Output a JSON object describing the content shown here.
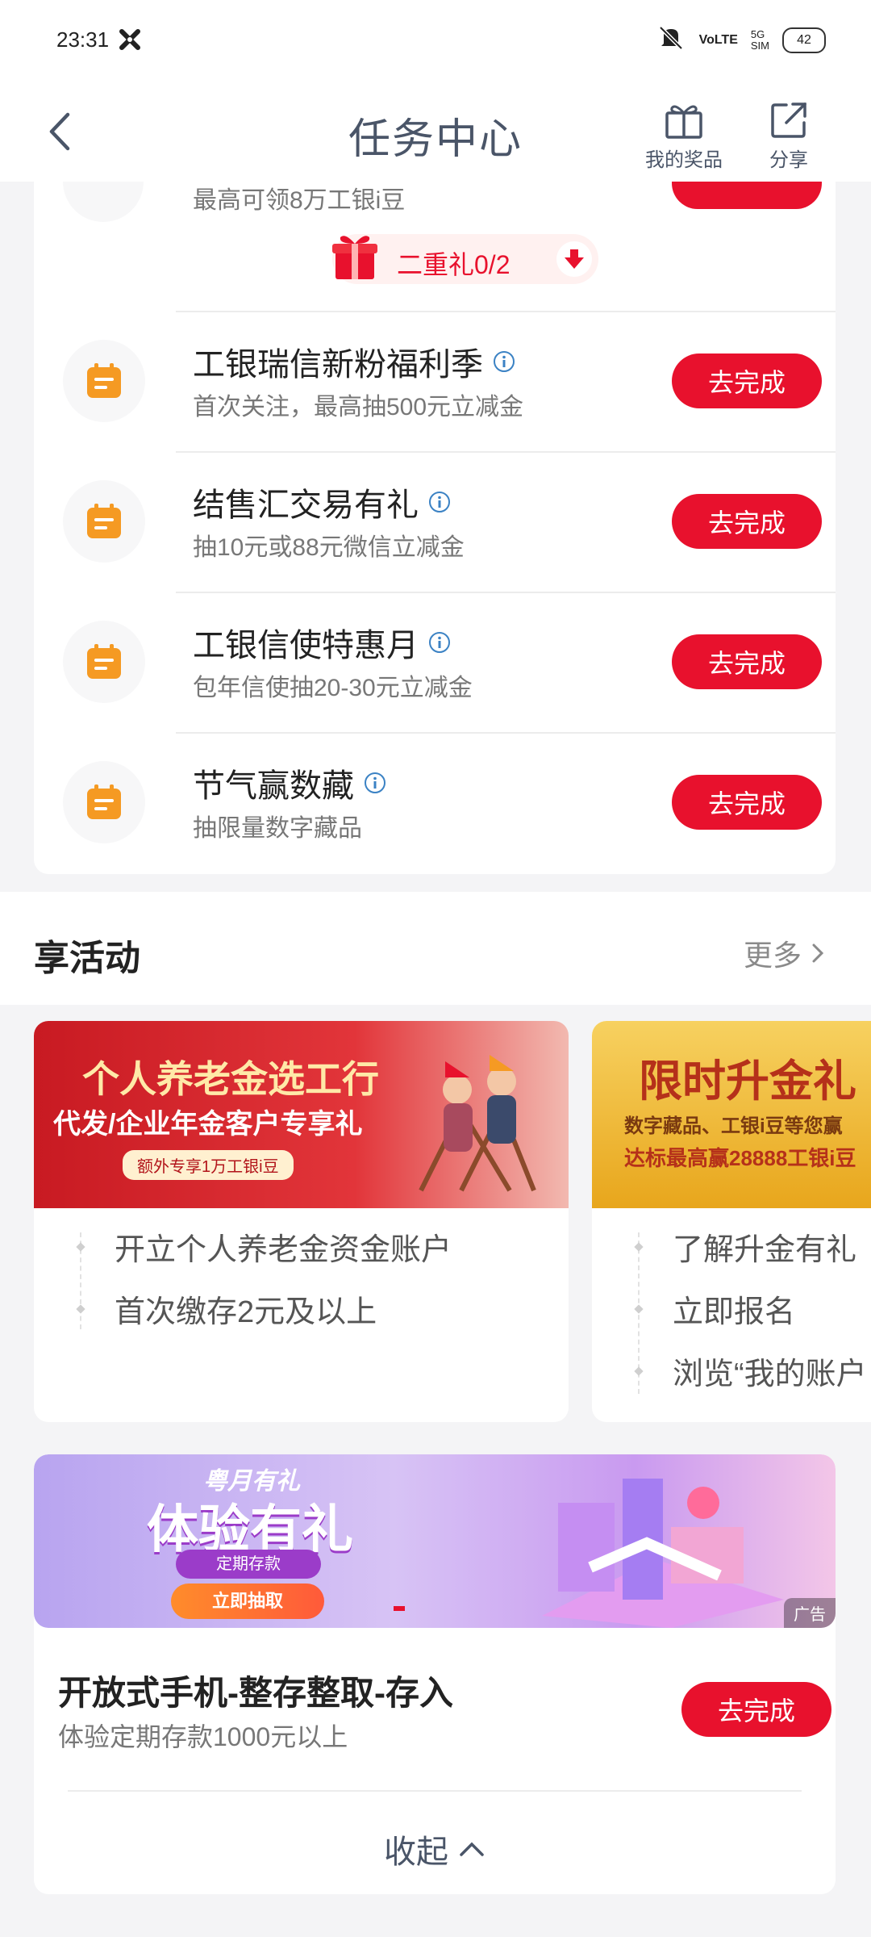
{
  "status_bar": {
    "time": "23:31",
    "signal_5g": "5G",
    "signal_sim": "SIM",
    "volte": "VoLTE",
    "battery": "42"
  },
  "header": {
    "title": "任务中心",
    "back_icon": "chevron-left-icon",
    "my_prizes": "我的奖品",
    "share": "分享"
  },
  "tasks": {
    "partial_subtitle": "最高可领8万工银i豆",
    "gift_label": "二重礼0/2",
    "items": [
      {
        "title": "工银瑞信新粉福利季",
        "subtitle": "首次关注，最高抽500元立减金",
        "button": "去完成"
      },
      {
        "title": "结售汇交易有礼",
        "subtitle": "抽10元或88元微信立减金",
        "button": "去完成"
      },
      {
        "title": "工银信使特惠月",
        "subtitle": "包年信使抽20-30元立减金",
        "button": "去完成"
      },
      {
        "title": "节气赢数藏",
        "subtitle": "抽限量数字藏品",
        "button": "去完成"
      }
    ]
  },
  "activities": {
    "section_title": "享活动",
    "more": "更多",
    "cards": [
      {
        "banner_line1": "个人养老金选工行",
        "banner_line2": "代发/企业年金客户专享礼",
        "banner_line3": "额外专享1万工银i豆",
        "steps": [
          "开立个人养老金资金账户",
          "首次缴存2元及以上"
        ]
      },
      {
        "banner_line1": "限时升金礼",
        "banner_line2": "数字藏品、工银i豆等您赢",
        "banner_line3": "达标最高赢28888工银i豆",
        "steps": [
          "了解升金有礼",
          "立即报名",
          "浏览“我的账户"
        ]
      }
    ]
  },
  "promo": {
    "tag": "粤月有礼",
    "headline": "体验有礼",
    "pill1": "定期存款",
    "pill2": "立即抽取",
    "ad": "广告",
    "task_title": "开放式手机-整存整取-存入",
    "task_subtitle": "体验定期存款1000元以上",
    "button": "去完成",
    "collapse": "收起"
  },
  "colors": {
    "accent_red": "#e8112d",
    "icon_orange": "#f59a23",
    "text_gray": "#777777",
    "title_slate": "#4a5568"
  }
}
